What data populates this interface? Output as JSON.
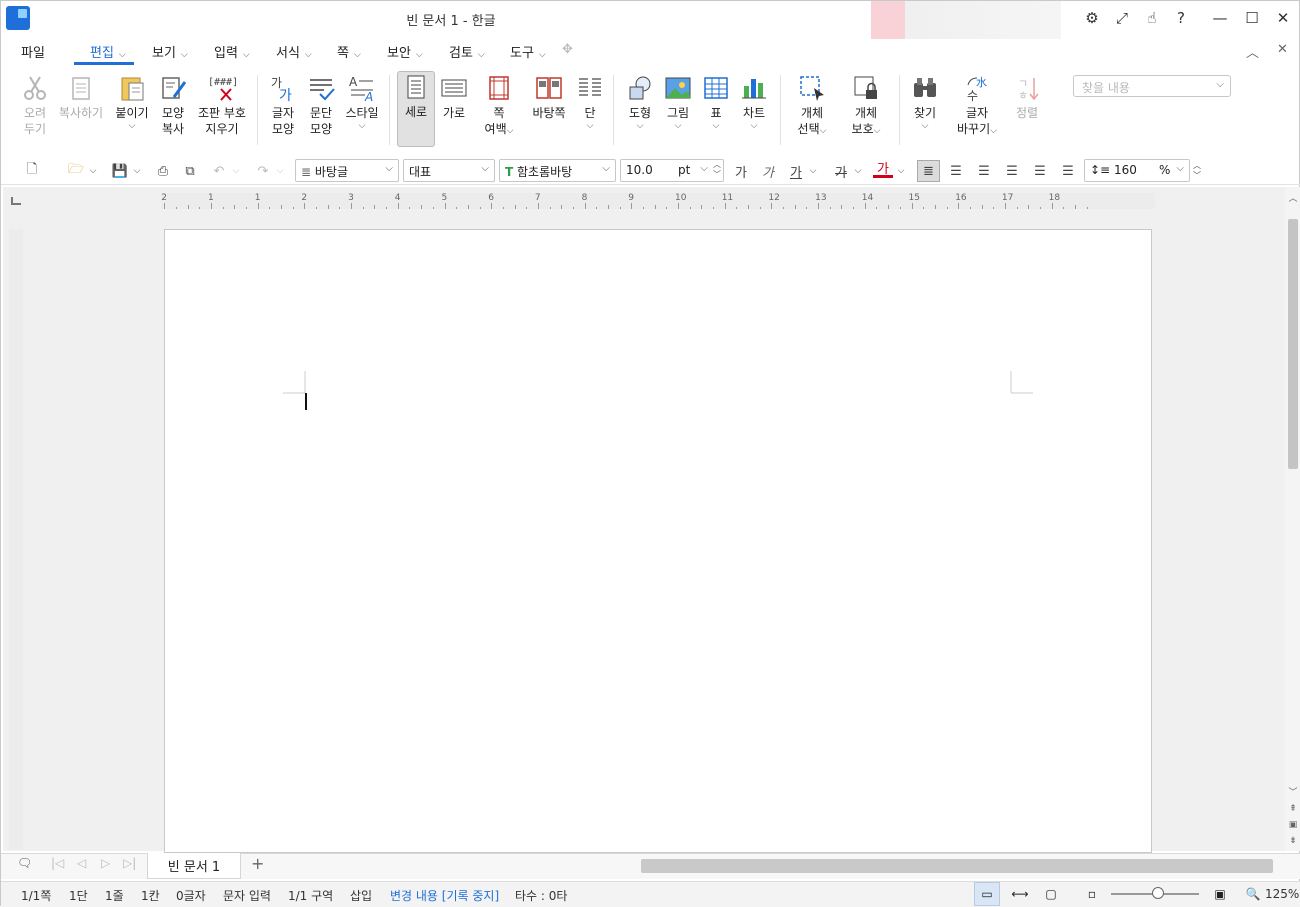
{
  "window": {
    "title": "빈 문서 1 - 한글"
  },
  "menu": {
    "file": "파일",
    "items": [
      "편집",
      "보기",
      "입력",
      "서식",
      "쪽",
      "보안",
      "검토",
      "도구"
    ],
    "search_placeholder": "찾을 내용"
  },
  "ribbon": {
    "cut": [
      "오려",
      "두기"
    ],
    "copy": "복사하기",
    "paste": "붙이기",
    "format_copy": [
      "모양",
      "복사"
    ],
    "erase_marks": [
      "조판 부호",
      "지우기"
    ],
    "char_shape": [
      "글자",
      "모양"
    ],
    "para_shape": [
      "문단",
      "모양"
    ],
    "style": "스타일",
    "portrait": "세로",
    "landscape": "가로",
    "page_margin": [
      "쪽",
      "여백"
    ],
    "master_page": "바탕쪽",
    "columns": "단",
    "shape": "도형",
    "picture": "그림",
    "table": "표",
    "chart": "차트",
    "obj_select": [
      "개체",
      "선택"
    ],
    "obj_protect": [
      "개체",
      "보호"
    ],
    "find": "찾기",
    "replace": [
      "글자",
      "바꾸기"
    ],
    "sort": "정렬"
  },
  "format": {
    "style": "바탕글",
    "lang": "대표",
    "font": "함초롬바탕",
    "size": "10.0",
    "unit": "pt",
    "bold": "가",
    "italic": "가",
    "underline": "가",
    "strike": "가",
    "color": "가",
    "line_spacing": "160",
    "percent": "%"
  },
  "ruler": {
    "h_numbers": [
      "2",
      "1",
      "1",
      "2",
      "3",
      "4",
      "5",
      "6",
      "7",
      "8",
      "9",
      "10",
      "11",
      "12",
      "13",
      "14",
      "15",
      "16",
      "17",
      "18"
    ]
  },
  "tabs": {
    "doc": "빈 문서 1",
    "add": "+"
  },
  "status": {
    "page": "1/1쪽",
    "col": "1단",
    "line": "1줄",
    "kan": "1칸",
    "chars": "0글자",
    "mode": "문자 입력",
    "section": "1/1 구역",
    "insert": "삽입",
    "track": "변경 내용 [기록 중지]",
    "strokes": "타수 : 0타",
    "zoom": "125%"
  },
  "colors": {
    "accent": "#1f6fd6",
    "font_color": "#d0021b"
  }
}
